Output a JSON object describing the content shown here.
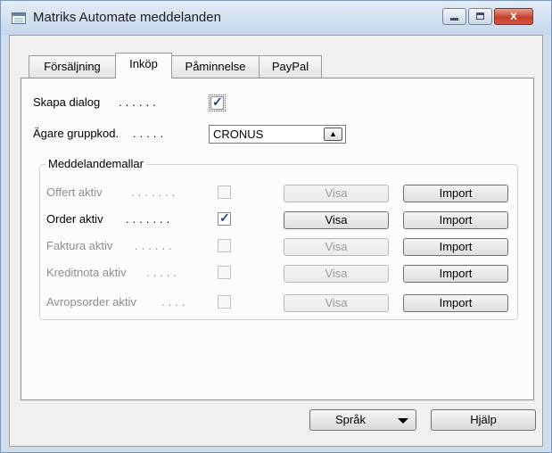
{
  "window": {
    "title": "Matriks Automate meddelanden",
    "close_label": "x"
  },
  "tabs": [
    {
      "label": "Försäljning",
      "active": false
    },
    {
      "label": "Inköp",
      "active": true
    },
    {
      "label": "Påminnelse",
      "active": false
    },
    {
      "label": "PayPal",
      "active": false
    }
  ],
  "form": {
    "skapa_dialog_label": "Skapa dialog",
    "skapa_dialog_checked": true,
    "agare_label": "Ägare gruppkod.",
    "agare_value": "CRONUS",
    "dots_short": ".....",
    "dots_long": "......"
  },
  "group": {
    "title": "Meddelandemallar",
    "rows": [
      {
        "label": "Offert aktiv",
        "dots": ".......",
        "checked": false,
        "enabled": false,
        "visa": "Visa",
        "import": "Import"
      },
      {
        "label": "Order aktiv",
        "dots": ".......",
        "checked": true,
        "enabled": true,
        "visa": "Visa",
        "import": "Import"
      },
      {
        "label": "Faktura aktiv",
        "dots": "......",
        "checked": false,
        "enabled": false,
        "visa": "Visa",
        "import": "Import"
      },
      {
        "label": "Kreditnota aktiv",
        "dots": ".....",
        "checked": false,
        "enabled": false,
        "visa": "Visa",
        "import": "Import"
      },
      {
        "label": "Avropsorder aktiv",
        "dots": "....",
        "checked": false,
        "enabled": false,
        "visa": "Visa",
        "import": "Import"
      }
    ]
  },
  "buttons": {
    "sprak": "Språk",
    "hjalp": "Hjälp"
  },
  "icons": [
    "window-icon",
    "minimize-icon",
    "maximize-icon",
    "close-icon",
    "lookup-arrow-icon",
    "dropdown-arrow-icon"
  ]
}
